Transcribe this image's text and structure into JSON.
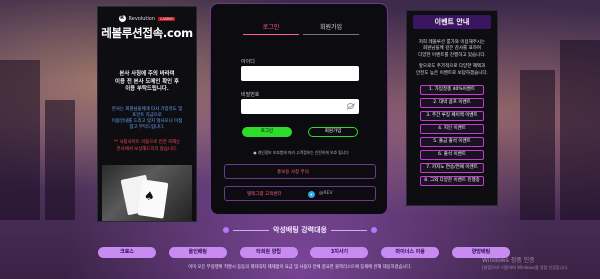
{
  "left": {
    "logo_text": "Revolution",
    "logo_badge": "CASINO",
    "title": "레볼루션접속.com",
    "warning_line1": "본사 사칭에 주의 바라며",
    "warning_line2": "이용 전 본사 도메인 확인 후",
    "warning_line3": "이용 부탁드립니다.",
    "blue_line1": "본사는 회원님들에게 타사 가입유도 및",
    "blue_line2": "포인트 지급으로",
    "blue_line3": "이용안내를 드리고 있지 않사오니 이점",
    "blue_line4": "참고 부탁드립니다.",
    "red_line1": "** 사칭사이트 이용으로 인한 피해는",
    "red_line2": "본사에서 보상해드리지 않습니다."
  },
  "login": {
    "tab_login": "로그인",
    "tab_signup": "회원가입",
    "id_label": "아이디",
    "pw_label": "비밀번호",
    "login_button": "로그인",
    "signup_button": "회원가입",
    "notice": "● 개인정보 보호법에 따라 고객정보는 안전하게 보호 됩니다",
    "box1_text": "홍보용 사칭 주의",
    "box2_text": "텔레그램 고객센터",
    "box2_right": "@REV",
    "tg_glyph": "✈"
  },
  "right": {
    "heading": "이벤트 안내",
    "text1_line1": "저희 레볼루션 룸가와 이용해주시는",
    "text1_line2": "회원님들께 깊은 감사를 표하며",
    "text1_line3": "다양한 이벤트를 진행하고 있습니다.",
    "text2_line1": "앞으로도 추가적으로 다양한 혜택과",
    "text2_line2": "안전도 높은 이벤트로 보답하겠습니다.",
    "events": [
      "1. 가입첫충 40%이벤트",
      "2. 대박 콤프 이벤트",
      "3. 주간 루징 페이백 이벤트",
      "4. 지인 이벤트",
      "5. 출금 출석 이벤트",
      "6. 출석 이벤트",
      "7. 카지노 연승/연패 이벤트",
      "8. 그외 다양한 이벤트 진행중"
    ]
  },
  "bottom": {
    "title": "악성배팅 강력대응",
    "categories": [
      "크로스",
      "올인배팅",
      "타회원 양립",
      "3지사기",
      "마이너스 이용",
      "양방배팅"
    ],
    "desc": "이미 모든 부정행위 적발시 등등의 계좌대처 제재없이 요금 및 사용자 전체 중요한 블랙리스트에 등재에 관해 대응하겠습니다.",
    "win_title": "Windows 정품 인증",
    "win_sub": "[설정]으로 이동하여 Windows를 정품 인증합니다."
  }
}
